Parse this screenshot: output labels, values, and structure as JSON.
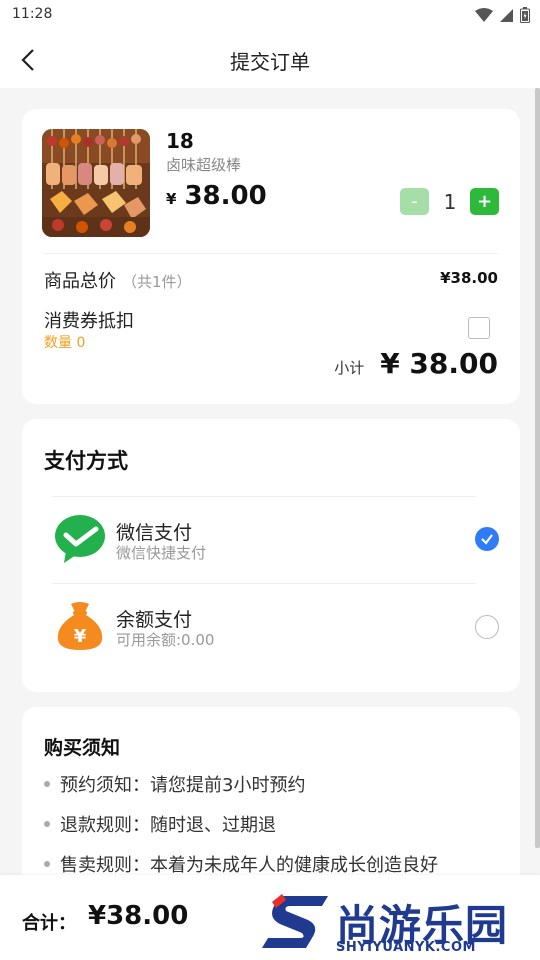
{
  "status_bar": {
    "time": "11:28"
  },
  "header": {
    "title": "提交订单"
  },
  "order": {
    "product_name": "18",
    "product_subtitle": "卤味超级棒",
    "currency": "¥",
    "price": "38.00",
    "quantity": "1",
    "minus_label": "-",
    "plus_label": "+",
    "total_label": "商品总价",
    "total_count": "（共1件）",
    "total_value": "¥38.00",
    "coupon_label": "消费券抵扣",
    "coupon_count": "数量 0",
    "subtotal_label": "小计",
    "subtotal_value": "¥ 38.00"
  },
  "payment": {
    "title": "支付方式",
    "methods": [
      {
        "name": "微信支付",
        "desc": "微信快捷支付",
        "selected": true,
        "icon": "wechat-pay-icon"
      },
      {
        "name": "余额支付",
        "desc": "可用余额:0.00",
        "selected": false,
        "icon": "balance-bag-icon"
      }
    ]
  },
  "notice": {
    "title": "购买须知",
    "items": [
      "预约须知：请您提前3小时预约",
      "退款规则：随时退、过期退",
      "售卖规则：本着为未成年人的健康成长创造良好"
    ]
  },
  "footer": {
    "sum_label": "合计：",
    "sum_value": "¥38.00"
  },
  "watermark": {
    "brand": "尚游乐园",
    "url": "SHYIYUANYK.COM"
  },
  "colors": {
    "accent_green": "#2dba3b",
    "accent_blue": "#2f7cf6",
    "coupon_orange": "#f0a020",
    "wechat_green": "#22b14c",
    "balance_orange": "#f58a1f",
    "brand_navy": "#1f3a8f",
    "brand_red": "#e8302a"
  }
}
